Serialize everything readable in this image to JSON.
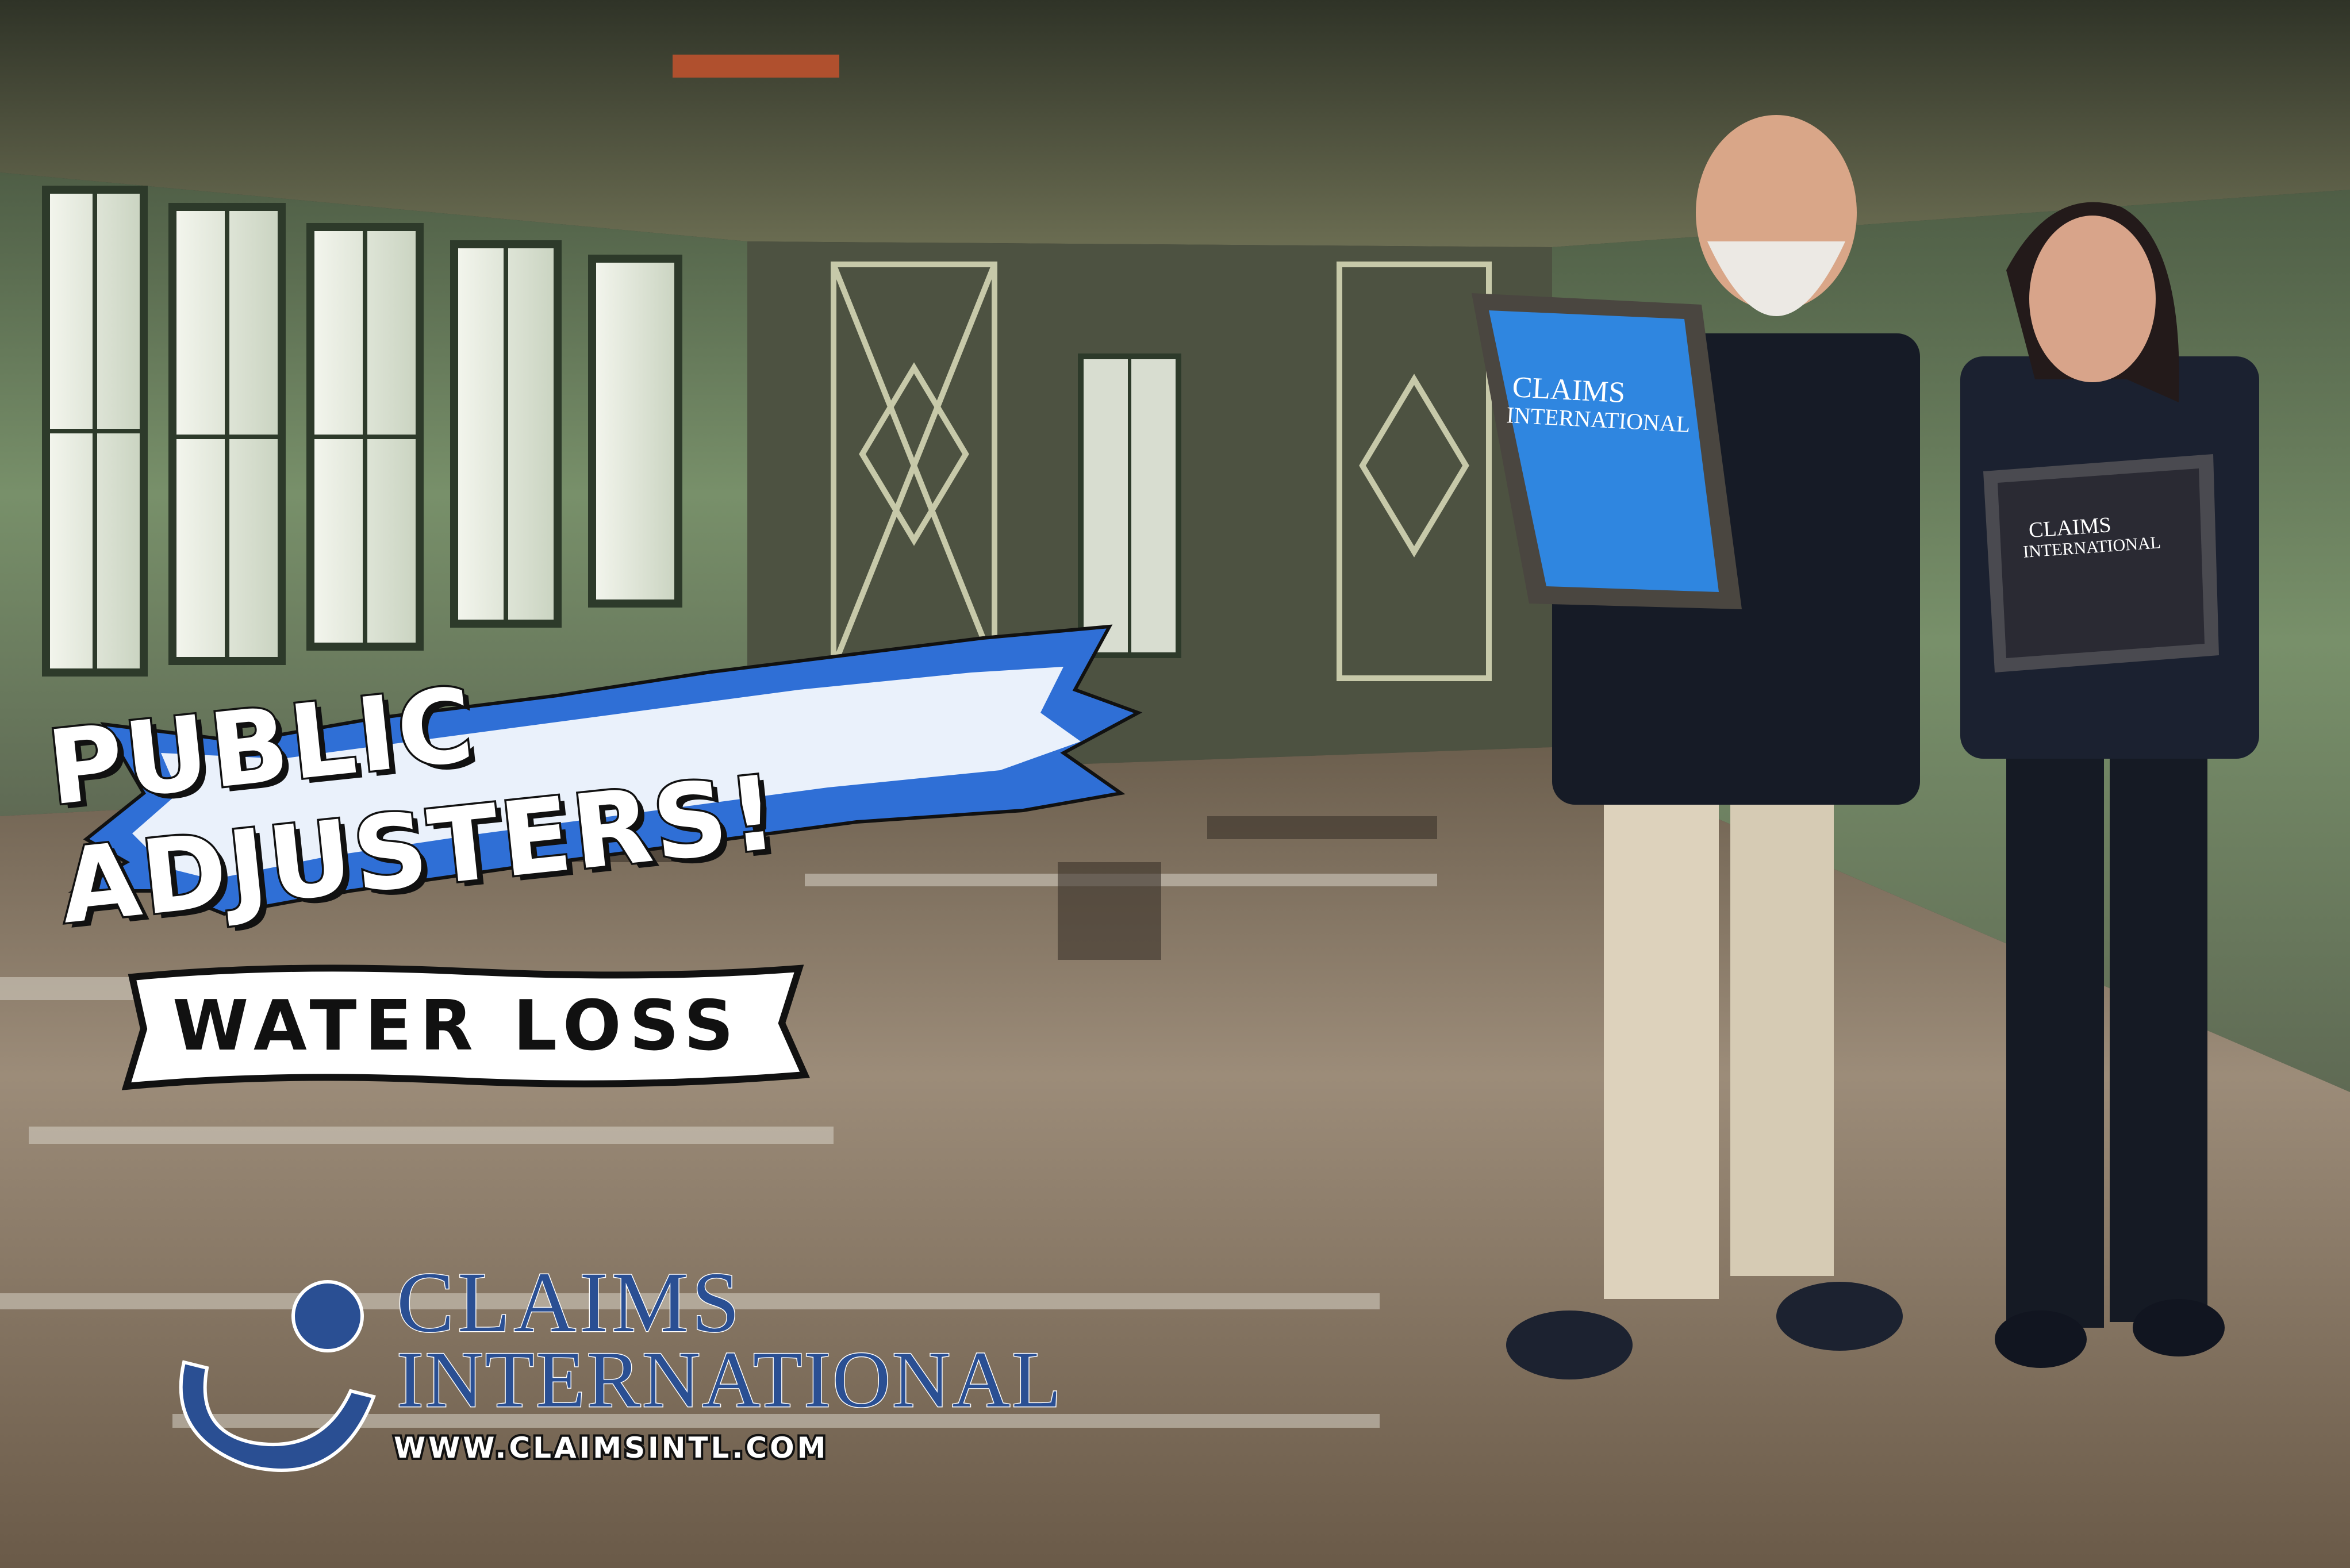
{
  "headline": "PUBLIC ADJUSTERS!",
  "tag_label": "WATER LOSS",
  "logo": {
    "word1": "CLAIMS",
    "word2": "INTERNATIONAL",
    "url": "WWW.CLAIMSINTL.COM"
  },
  "tablet_left": {
    "line1": "CLAIMS",
    "line2": "INTERNATIONAL"
  },
  "tablet_right": {
    "line1": "CLAIMS",
    "line2": "INTERNATIONAL"
  },
  "colors": {
    "banner_blue": "#2f6fd6",
    "logo_blue": "#2a4f93",
    "tablet_blue": "#2f86e0",
    "wall_green": "#6f8b63",
    "floor_brown": "#7a6a58"
  }
}
